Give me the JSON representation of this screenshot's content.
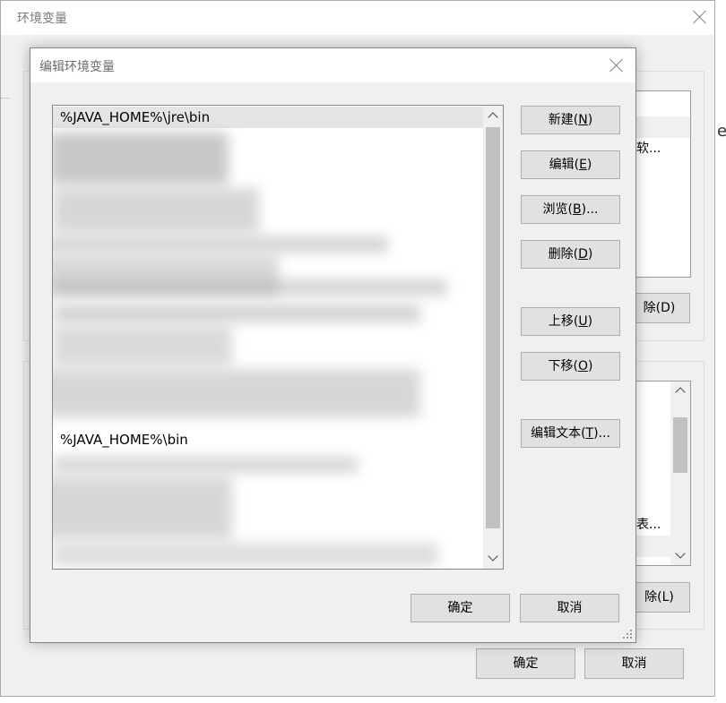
{
  "background": {
    "title": "环境变量",
    "top_list_row3": "软...",
    "top_delete_label": "除(D)",
    "bottom_list_row1": "表...",
    "bottom_delete_label": "除(L)",
    "ok_label": "确定",
    "cancel_label": "取消",
    "edge_text": "e"
  },
  "dialog": {
    "title": "编辑环境变量",
    "paths": [
      "%JAVA_HOME%\\jre\\bin",
      "%JAVA_HOME%\\bin"
    ],
    "buttons": {
      "new": {
        "text": "新建(",
        "key": "N",
        "tail": ")"
      },
      "edit": {
        "text": "编辑(",
        "key": "E",
        "tail": ")"
      },
      "browse": {
        "text": "浏览(",
        "key": "B",
        "tail": ")..."
      },
      "delete": {
        "text": "删除(",
        "key": "D",
        "tail": ")"
      },
      "up": {
        "text": "上移(",
        "key": "U",
        "tail": ")"
      },
      "down": {
        "text": "下移(",
        "key": "O",
        "tail": ")"
      },
      "edit_text": {
        "text": "编辑文本(",
        "key": "T",
        "tail": ")..."
      }
    },
    "ok_label": "确定",
    "cancel_label": "取消"
  },
  "colors": {
    "window_bg": "#f0f0f0",
    "button_bg": "#e1e1e1",
    "selected_row": "#e5e5e5",
    "scroll_thumb": "#c1c1c1"
  }
}
